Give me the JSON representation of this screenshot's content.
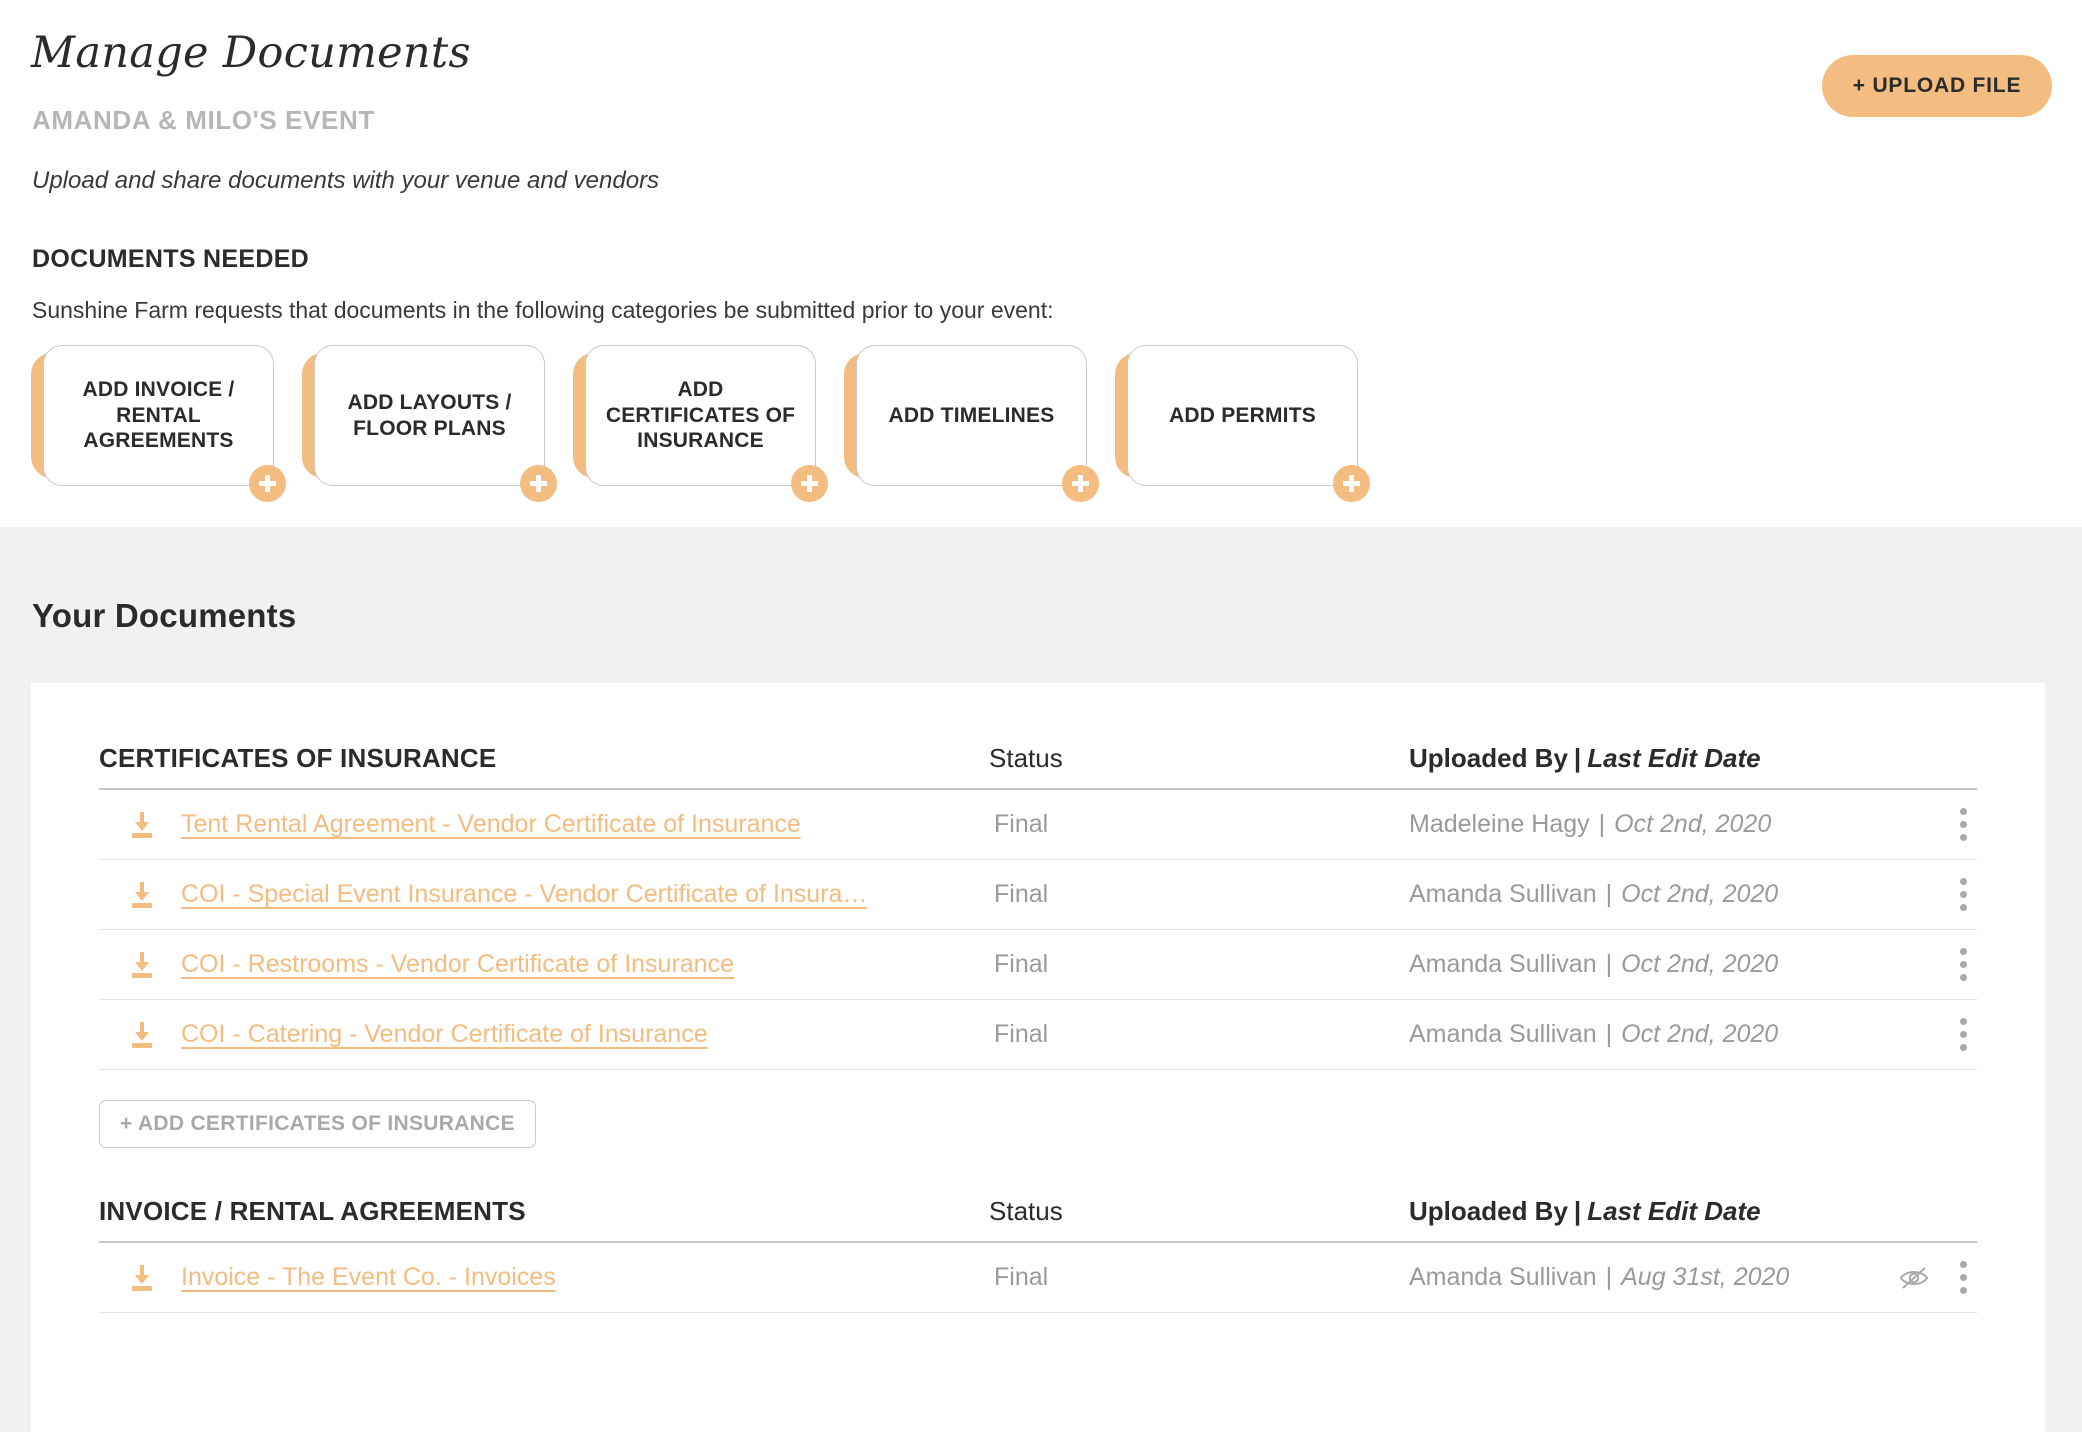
{
  "header": {
    "title": "Manage Documents",
    "event_name": "AMANDA & MILO'S EVENT",
    "subtitle": "Upload and share documents with your venue and vendors",
    "upload_button": "+ UPLOAD FILE"
  },
  "documents_needed": {
    "label": "DOCUMENTS NEEDED",
    "description": "Sunshine Farm requests that documents in the following categories be submitted prior to your event:",
    "cards": [
      {
        "label": "ADD INVOICE / RENTAL AGREEMENTS"
      },
      {
        "label": "ADD LAYOUTS / FLOOR PLANS"
      },
      {
        "label": "ADD CERTIFICATES OF INSURANCE"
      },
      {
        "label": "ADD TIMELINES"
      },
      {
        "label": "ADD PERMITS"
      }
    ]
  },
  "your_documents": {
    "title": "Your Documents",
    "columns": {
      "status": "Status",
      "uploaded_by": "Uploaded By",
      "separator": "|",
      "last_edit_date": "Last Edit Date"
    },
    "sections": [
      {
        "title": "CERTIFICATES OF INSURANCE",
        "add_button": "+ ADD CERTIFICATES OF INSURANCE",
        "rows": [
          {
            "name": "Tent Rental Agreement - Vendor Certificate of Insurance",
            "status": "Final",
            "uploaded_by": "Madeleine Hagy",
            "date": "Oct 2nd, 2020",
            "hidden": false
          },
          {
            "name": "COI - Special Event Insurance - Vendor Certificate of Insura…",
            "status": "Final",
            "uploaded_by": "Amanda Sullivan",
            "date": "Oct 2nd, 2020",
            "hidden": false
          },
          {
            "name": "COI - Restrooms - Vendor Certificate of Insurance",
            "status": "Final",
            "uploaded_by": "Amanda Sullivan",
            "date": "Oct 2nd, 2020",
            "hidden": false
          },
          {
            "name": "COI - Catering - Vendor Certificate of Insurance",
            "status": "Final",
            "uploaded_by": "Amanda Sullivan",
            "date": "Oct 2nd, 2020",
            "hidden": false
          }
        ]
      },
      {
        "title": "INVOICE / RENTAL AGREEMENTS",
        "add_button": "",
        "rows": [
          {
            "name": "Invoice - The Event Co. - Invoices",
            "status": "Final",
            "uploaded_by": "Amanda Sullivan",
            "date": "Aug 31st, 2020",
            "hidden": true
          }
        ]
      }
    ]
  },
  "colors": {
    "accent": "#F3BC80",
    "gray_bg": "#F2F1EF",
    "text_dark": "#2B2B2B",
    "text_muted": "#9A9A9A"
  },
  "icons": {
    "download": "download-icon",
    "kebab": "more-options-icon",
    "eye_slash": "hidden-eye-icon",
    "plus": "plus-icon"
  }
}
